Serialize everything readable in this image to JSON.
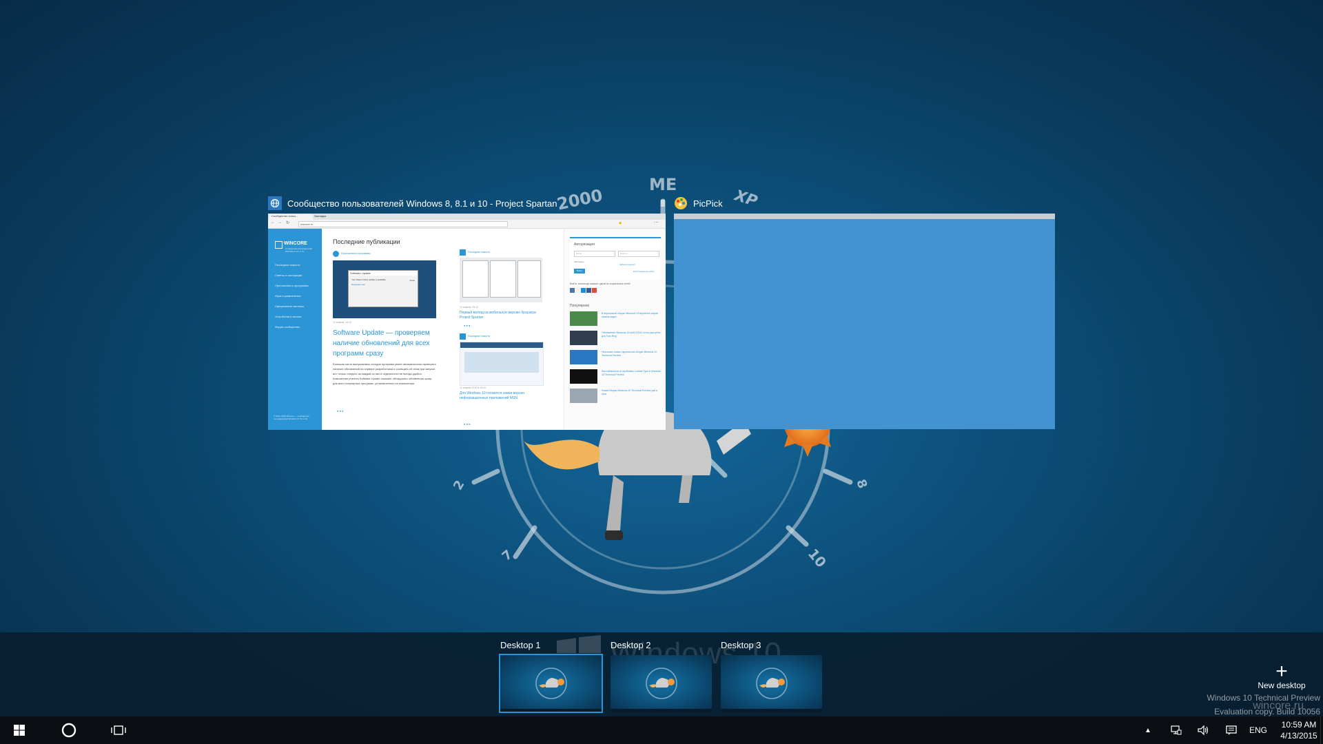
{
  "wallpaper": {
    "labels": [
      "2000",
      "ME",
      "XP",
      "2",
      "10",
      "7",
      "8"
    ]
  },
  "windows": [
    {
      "app_name": "Сообщество пользователей Windows 8, 8.1 и 10 - Project Spartan",
      "icon": "globe-icon",
      "browser": {
        "tabs": [
          "Сообщество польз...",
          "Закладки"
        ],
        "address": "wincore.ru",
        "site_logo": "WINCORE",
        "site_subtitle": "Сообщество пользователей Windows 8, 8.1 и 10",
        "nav": [
          "Последние новости",
          "Советы и инструкции",
          "Приложения и программы",
          "Игры и развлечения",
          "Оформление системы",
          "Устройства и железо",
          "Форум сообщества"
        ],
        "footer": "© 2012–2015 Wincore — сообщество пользователей Windows 8, 8.1 и 10",
        "heading": "Последние публикации",
        "article_main": {
          "category": "Приложения и программы",
          "date": "13 апреля, 16:12",
          "title": "Software Update — проверяем наличие обновлений для всех программ сразу",
          "text": "Большая часть выпускаемых сегодня программ умеет автоматически проверять наличие обновлений на сервере разработчика и сообщать об этом при запуске, вот только следить за каждой из них в отдельности не всегда удобно. Компактная утилита Software Update поможет обнаружить обновления сразу для всех популярных программ, установленных на компьютере.",
          "dialog_title": "Software Update",
          "dialog_text": "Your Steam Client update is available",
          "dialog_link": "Download now",
          "dialog_close": "Close"
        },
        "article_2": {
          "category": "Последние новости",
          "date": "13 апреля, 09:12",
          "title": "Первый взгляд на мобильную версию браузера Project Spartan"
        },
        "article_3": {
          "category": "Последние новости",
          "date": "12 апреля 2015 в 15:44",
          "title": "Для Windows 10 готовится новая версия информационных приложений MSN"
        },
        "auth": {
          "title": "Авторизация",
          "login_placeholder": "Логин",
          "password_placeholder": "Пароль",
          "remember": "Запомнить",
          "forgot": "Забыли пароль?",
          "submit": "Войти",
          "register": "Регистрация на сайте"
        },
        "social_text": "Войти, используя аккаунт одной из социальных сетей",
        "popular_heading": "Популярное",
        "popular": [
          "В апрельской сборке Windows 10 вернется старая панель задач",
          "Обновление Windows 10 build 10041 стало доступно для Fast Ring",
          "Несколько новых скриншотов сборки Windows 10 Technical Preview",
          "Как избавиться от проблемы с меню Пуск в Windows 10 Technical Preview",
          "Новая сборка Windows 10 Technical Preview уже в пути"
        ]
      }
    },
    {
      "app_name": "PicPick",
      "icon": "picpick-icon"
    }
  ],
  "desktops": [
    {
      "label": "Desktop 1",
      "active": true
    },
    {
      "label": "Desktop 2",
      "active": false
    },
    {
      "label": "Desktop 3",
      "active": false
    }
  ],
  "new_desktop": "New desktop",
  "watermark_text": "Windows 10",
  "eval_text": {
    "line1": "Windows 10 Technical Preview",
    "line2": "Evaluation copy. Build 10056",
    "site": "wincore.ru"
  },
  "taskbar": {
    "language": "ENG",
    "time": "10:59 AM",
    "date": "4/13/2015"
  },
  "colors": {
    "accent": "#2b95d6",
    "picpick_blue": "#4393d2",
    "taskbar": "#0b0f13"
  }
}
